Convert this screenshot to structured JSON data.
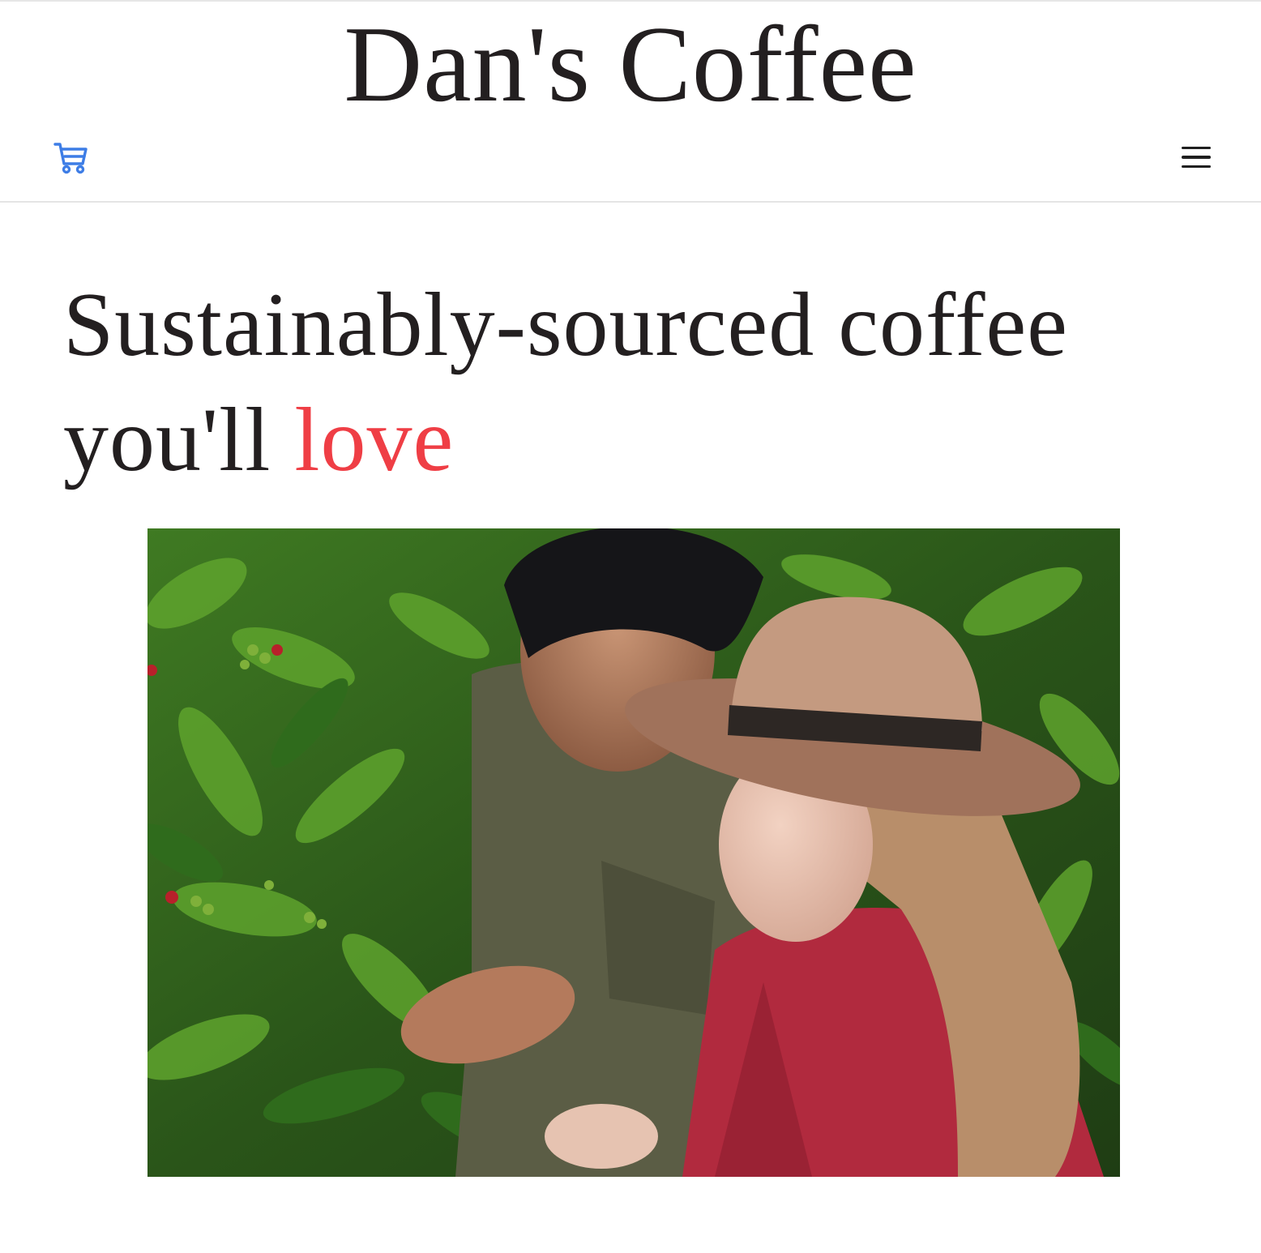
{
  "header": {
    "site_title": "Dan's Coffee",
    "cart_icon": "shopping-cart-icon",
    "menu_icon": "hamburger-menu-icon"
  },
  "hero": {
    "headline_part1": "Sustainably-sourced coffee you'll ",
    "headline_accent": "love",
    "image_icon": "photo-coffee-farmers"
  },
  "colors": {
    "accent": "#ef3e45",
    "text": "#231f20",
    "cart_icon": "#3d7de6"
  }
}
